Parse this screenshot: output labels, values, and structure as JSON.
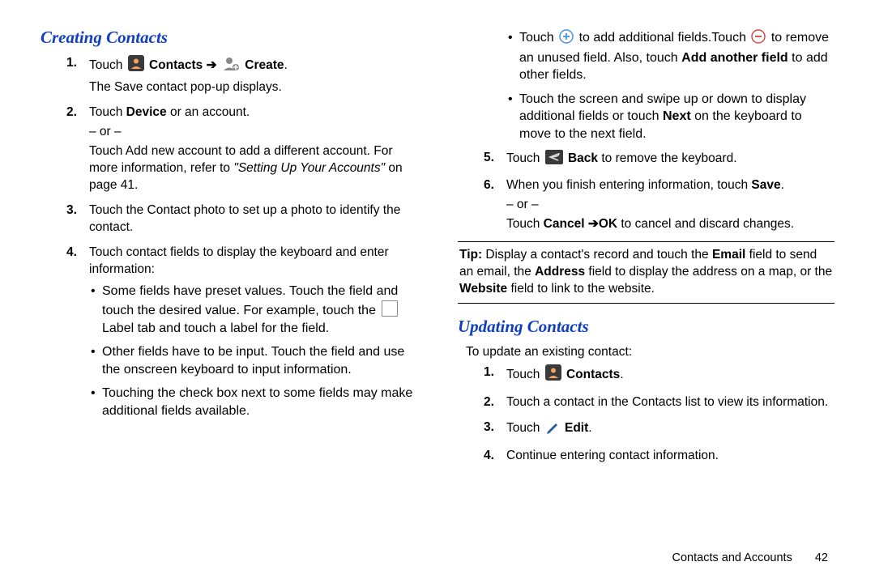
{
  "left": {
    "heading": "Creating Contacts",
    "step1a": "Touch ",
    "step1b": " Contacts",
    "step1c": " Create",
    "step1d": ".",
    "step1e": "The Save contact pop-up displays.",
    "step2a": "Touch ",
    "step2b": "Device",
    "step2c": " or an account.",
    "or": "– or –",
    "step2d": "Touch Add new account to add a different account. For more information, refer to ",
    "step2e": "\"Setting Up Your Accounts\"",
    "step2f": " on page 41.",
    "step3": "Touch the Contact photo to set up a photo to identify the contact.",
    "step4": "Touch contact fields to display the keyboard and enter information:",
    "b1a": "Some fields have preset values. Touch the field and touch the desired value. For example, touch the ",
    "b1b": " Label tab and touch a label for the field.",
    "b2": "Other fields have to be input. Touch the field and use the onscreen keyboard to input information.",
    "b3": "Touching the check box next to some fields may make additional fields available."
  },
  "right": {
    "rb1a": "Touch ",
    "rb1b": " to add additional fields.Touch ",
    "rb1c": " to remove an unused field. Also, touch ",
    "rb1d": "Add another field",
    "rb1e": " to add other fields.",
    "rb2a": "Touch the screen and swipe up or down to display additional fields or touch ",
    "rb2b": "Next",
    "rb2c": " on the keyboard to move to the next field.",
    "step5a": "Touch ",
    "step5b": " Back",
    "step5c": " to remove the keyboard.",
    "step6a": "When you finish entering information, touch ",
    "step6b": "Save",
    "step6c": ".",
    "or": "– or –",
    "step6d": "Touch ",
    "step6e": "Cancel",
    "step6arrow": " ",
    "step6f": "OK",
    "step6g": " to cancel and discard changes.",
    "tip_label": "Tip:",
    "tip_a": " Display a contact's record and touch the ",
    "tip_b": "Email",
    "tip_c": " field to send an email, the ",
    "tip_d": "Address",
    "tip_e": " field to display the address on a map, or the ",
    "tip_f": "Website",
    "tip_g": " field to link to the website.",
    "heading2": "Updating Contacts",
    "intro2": "To update an existing contact:",
    "u1a": "Touch ",
    "u1b": " Contacts",
    "u1c": ".",
    "u2": "Touch a contact in the Contacts list to view its information.",
    "u3a": "Touch ",
    "u3b": " Edit",
    "u3c": ".",
    "u4": "Continue entering contact information."
  },
  "footer": {
    "section": "Contacts and Accounts",
    "page": "42"
  }
}
